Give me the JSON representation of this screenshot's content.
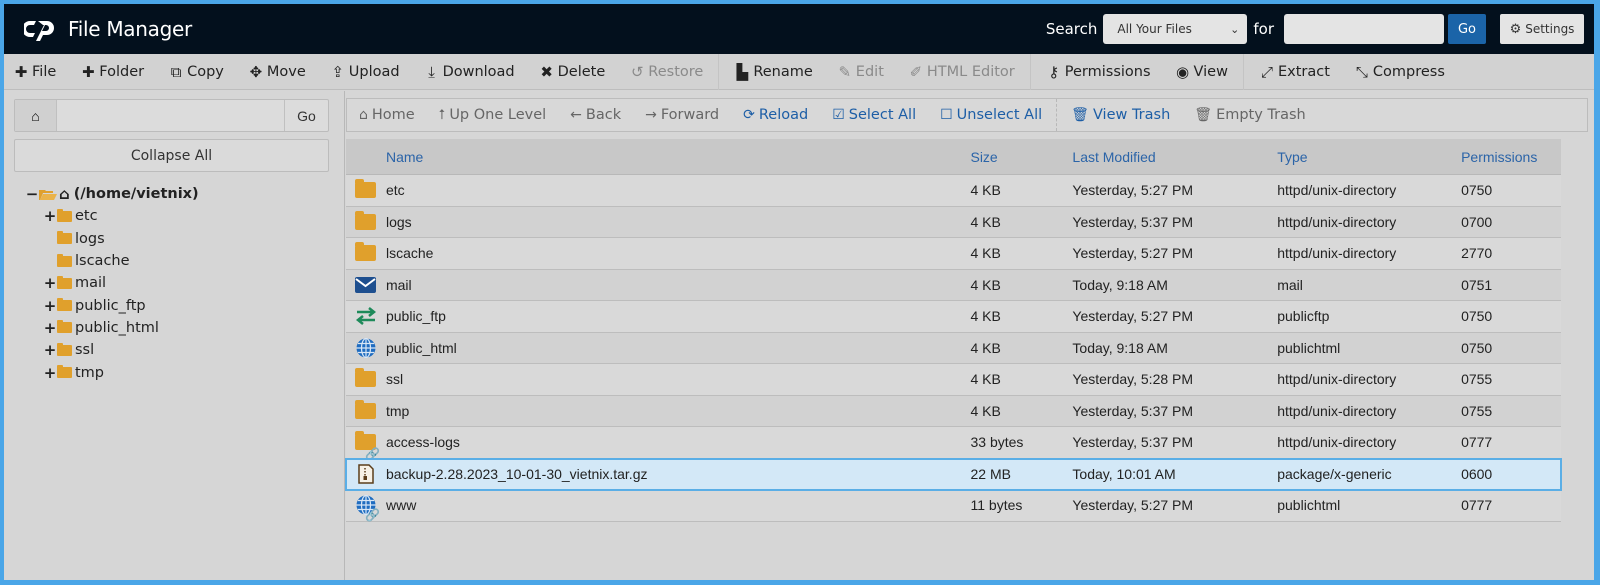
{
  "header": {
    "title": "File Manager",
    "search_label": "Search",
    "search_scope": "All Your Files",
    "for_label": "for",
    "search_value": "",
    "go_label": "Go",
    "settings_label": "Settings"
  },
  "toolbar": {
    "items": [
      {
        "label": "File",
        "icon": "plus-icon",
        "glyph": "✚",
        "disabled": false
      },
      {
        "label": "Folder",
        "icon": "plus-icon",
        "glyph": "✚",
        "disabled": false
      },
      {
        "label": "Copy",
        "icon": "copy-icon",
        "glyph": "⧉",
        "disabled": false
      },
      {
        "label": "Move",
        "icon": "move-icon",
        "glyph": "✥",
        "disabled": false
      },
      {
        "label": "Upload",
        "icon": "upload-icon",
        "glyph": "⇪",
        "disabled": false
      },
      {
        "label": "Download",
        "icon": "download-icon",
        "glyph": "⤓",
        "disabled": false
      },
      {
        "label": "Delete",
        "icon": "delete-icon",
        "glyph": "✖",
        "disabled": false
      },
      {
        "label": "Restore",
        "icon": "restore-icon",
        "glyph": "↺",
        "disabled": true
      },
      {
        "label": "Rename",
        "icon": "rename-icon",
        "glyph": "▙",
        "disabled": false
      },
      {
        "label": "Edit",
        "icon": "edit-icon",
        "glyph": "✎",
        "disabled": true
      },
      {
        "label": "HTML Editor",
        "icon": "html-editor-icon",
        "glyph": "✐",
        "disabled": true
      },
      {
        "label": "Permissions",
        "icon": "key-icon",
        "glyph": "⚷",
        "disabled": false
      },
      {
        "label": "View",
        "icon": "eye-icon",
        "glyph": "◉",
        "disabled": false
      },
      {
        "label": "Extract",
        "icon": "extract-icon",
        "glyph": "⤢",
        "disabled": false
      },
      {
        "label": "Compress",
        "icon": "compress-icon",
        "glyph": "⤡",
        "disabled": false
      }
    ]
  },
  "sidebar": {
    "path_value": "",
    "go_label": "Go",
    "collapse_label": "Collapse All",
    "root_label": "(/home/vietnix)",
    "tree": [
      {
        "label": "etc",
        "expandable": true
      },
      {
        "label": "logs",
        "expandable": false
      },
      {
        "label": "lscache",
        "expandable": false
      },
      {
        "label": "mail",
        "expandable": true
      },
      {
        "label": "public_ftp",
        "expandable": true
      },
      {
        "label": "public_html",
        "expandable": true
      },
      {
        "label": "ssl",
        "expandable": true
      },
      {
        "label": "tmp",
        "expandable": true
      }
    ]
  },
  "navbar": {
    "items": [
      {
        "label": "Home",
        "glyph": "⌂",
        "icon": "home-icon",
        "active": false
      },
      {
        "label": "Up One Level",
        "glyph": "⭡",
        "icon": "up-level-icon",
        "active": false
      },
      {
        "label": "Back",
        "glyph": "←",
        "icon": "back-arrow-icon",
        "active": false
      },
      {
        "label": "Forward",
        "glyph": "→",
        "icon": "forward-arrow-icon",
        "active": false
      },
      {
        "label": "Reload",
        "glyph": "⟳",
        "icon": "reload-icon",
        "active": true
      },
      {
        "label": "Select All",
        "glyph": "☑",
        "icon": "checkbox-checked-icon",
        "active": true
      },
      {
        "label": "Unselect All",
        "glyph": "☐",
        "icon": "checkbox-empty-icon",
        "active": true
      },
      {
        "label": "View Trash",
        "glyph": "🗑",
        "icon": "trash-icon",
        "active": true
      },
      {
        "label": "Empty Trash",
        "glyph": "🗑",
        "icon": "trash-icon",
        "active": false
      }
    ]
  },
  "table": {
    "columns": [
      "Name",
      "Size",
      "Last Modified",
      "Type",
      "Permissions"
    ],
    "rows": [
      {
        "icon": "folder",
        "name": "etc",
        "size": "4 KB",
        "modified": "Yesterday, 5:27 PM",
        "type": "httpd/unix-directory",
        "perms": "0750",
        "selected": false
      },
      {
        "icon": "folder",
        "name": "logs",
        "size": "4 KB",
        "modified": "Yesterday, 5:37 PM",
        "type": "httpd/unix-directory",
        "perms": "0700",
        "selected": false
      },
      {
        "icon": "folder",
        "name": "lscache",
        "size": "4 KB",
        "modified": "Yesterday, 5:27 PM",
        "type": "httpd/unix-directory",
        "perms": "2770",
        "selected": false
      },
      {
        "icon": "mail",
        "name": "mail",
        "size": "4 KB",
        "modified": "Today, 9:18 AM",
        "type": "mail",
        "perms": "0751",
        "selected": false
      },
      {
        "icon": "ftp",
        "name": "public_ftp",
        "size": "4 KB",
        "modified": "Yesterday, 5:27 PM",
        "type": "publicftp",
        "perms": "0750",
        "selected": false
      },
      {
        "icon": "globe",
        "name": "public_html",
        "size": "4 KB",
        "modified": "Today, 9:18 AM",
        "type": "publichtml",
        "perms": "0750",
        "selected": false
      },
      {
        "icon": "folder",
        "name": "ssl",
        "size": "4 KB",
        "modified": "Yesterday, 5:28 PM",
        "type": "httpd/unix-directory",
        "perms": "0755",
        "selected": false
      },
      {
        "icon": "folder",
        "name": "tmp",
        "size": "4 KB",
        "modified": "Yesterday, 5:37 PM",
        "type": "httpd/unix-directory",
        "perms": "0755",
        "selected": false
      },
      {
        "icon": "folder-link",
        "name": "access-logs",
        "size": "33 bytes",
        "modified": "Yesterday, 5:37 PM",
        "type": "httpd/unix-directory",
        "perms": "0777",
        "selected": false
      },
      {
        "icon": "archive",
        "name": "backup-2.28.2023_10-01-30_vietnix.tar.gz",
        "size": "22 MB",
        "modified": "Today, 10:01 AM",
        "type": "package/x-generic",
        "perms": "0600",
        "selected": true
      },
      {
        "icon": "globe-link",
        "name": "www",
        "size": "11 bytes",
        "modified": "Yesterday, 5:27 PM",
        "type": "publichtml",
        "perms": "0777",
        "selected": false
      }
    ]
  },
  "colors": {
    "header_bg": "#03101d",
    "accent_blue": "#1b64a8",
    "link_blue": "#2b64a8",
    "folder": "#e0a02c",
    "selection_bg": "#d3e8f7",
    "selection_border": "#5aaee6"
  }
}
